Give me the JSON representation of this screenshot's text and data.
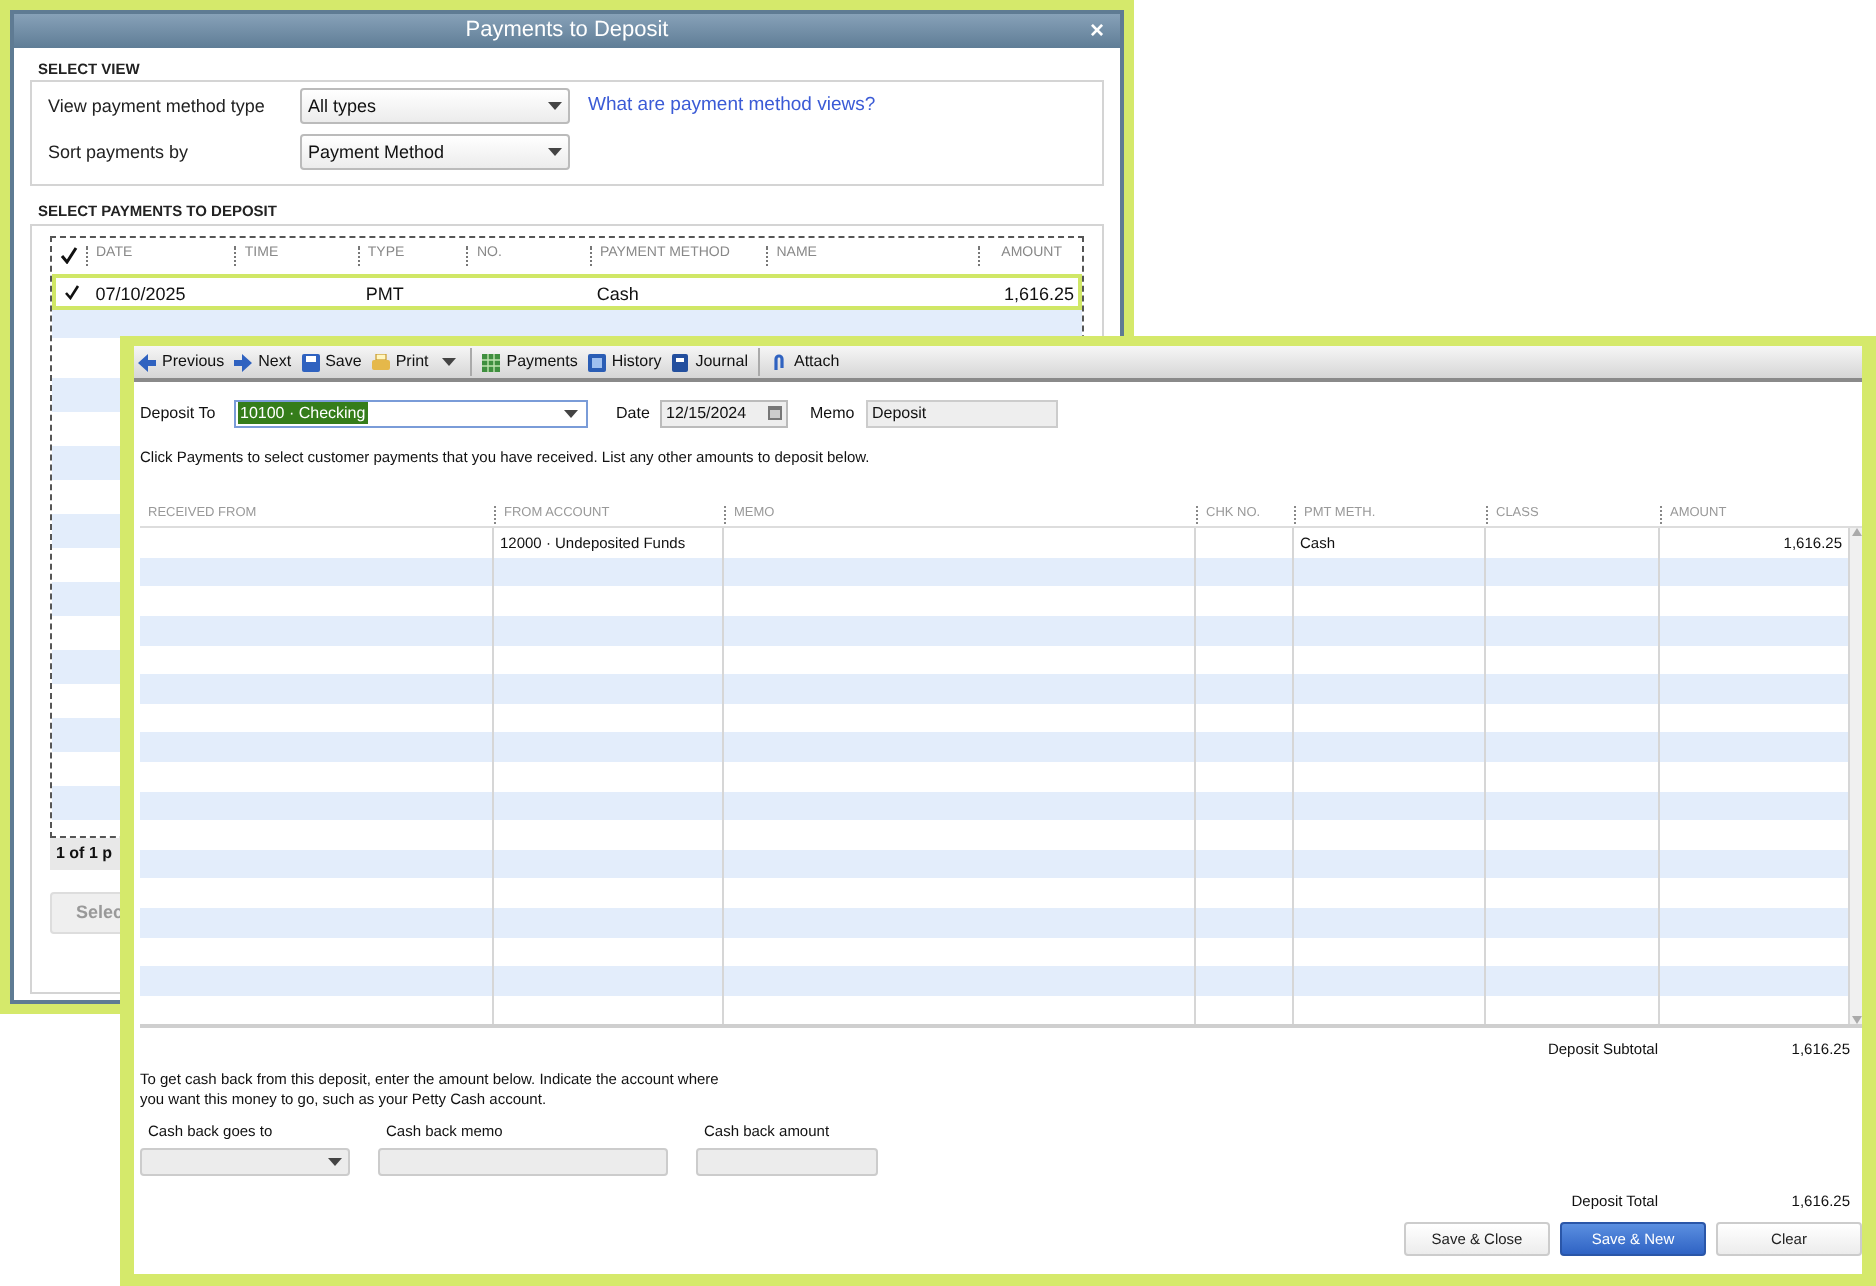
{
  "payments_window": {
    "title": "Payments to Deposit",
    "close": "×",
    "select_view": {
      "heading": "SELECT VIEW",
      "fields": [
        {
          "label": "View payment method type",
          "value": "All types"
        },
        {
          "label": "Sort payments by",
          "value": "Payment Method"
        }
      ],
      "help_link": "What are payment method views?"
    },
    "select_payments": {
      "heading": "SELECT PAYMENTS TO DEPOSIT",
      "columns": [
        "DATE",
        "TIME",
        "TYPE",
        "NO.",
        "PAYMENT METHOD",
        "NAME",
        "AMOUNT"
      ],
      "rows": [
        {
          "checked": true,
          "selected": true,
          "cells": [
            "07/10/2025",
            "",
            "PMT",
            "",
            "Cash",
            "",
            "1,616.25"
          ]
        }
      ],
      "pager": "1 of 1 p",
      "button": "Selec"
    }
  },
  "deposit_window": {
    "toolbar": [
      {
        "kind": "prev",
        "label": "Previous"
      },
      {
        "kind": "next",
        "label": "Next"
      },
      {
        "kind": "save",
        "label": "Save"
      },
      {
        "kind": "print",
        "label": "Print"
      },
      {
        "kind": "caret"
      },
      {
        "kind": "sep"
      },
      {
        "kind": "payments",
        "label": "Payments"
      },
      {
        "kind": "history",
        "label": "History"
      },
      {
        "kind": "journal",
        "label": "Journal"
      },
      {
        "kind": "sep"
      },
      {
        "kind": "attach",
        "label": "Attach"
      }
    ],
    "deposit_to": {
      "label": "Deposit To",
      "value": "10100 · Checking"
    },
    "date": {
      "label": "Date",
      "value": "12/15/2024"
    },
    "memo": {
      "label": "Memo",
      "value": "Deposit"
    },
    "instructions": "Click Payments to select customer payments that you have received. List any other amounts to deposit below.",
    "columns": [
      "RECEIVED FROM",
      "FROM ACCOUNT",
      "MEMO",
      "CHK NO.",
      "PMT METH.",
      "CLASS",
      "AMOUNT"
    ],
    "rows": [
      {
        "cells": [
          "",
          "12000 · Undeposited Funds",
          "",
          "",
          "Cash",
          "",
          "1,616.25"
        ]
      }
    ],
    "subtotal": {
      "label": "Deposit Subtotal",
      "value": "1,616.25"
    },
    "cash_back_note": "To get cash back from this deposit, enter the amount below.  Indicate the account where you want this money to go, such as your Petty Cash account.",
    "cash_back_fields": [
      {
        "kind": "dropdown",
        "label": "Cash back goes to"
      },
      {
        "kind": "text",
        "label": "Cash back memo"
      },
      {
        "kind": "text",
        "label": "Cash back amount"
      }
    ],
    "total": {
      "label": "Deposit Total",
      "value": "1,616.25"
    },
    "buttons": [
      {
        "label": "Save & Close",
        "primary": false
      },
      {
        "label": "Save & New",
        "primary": true
      },
      {
        "label": "Clear",
        "primary": false
      }
    ]
  }
}
